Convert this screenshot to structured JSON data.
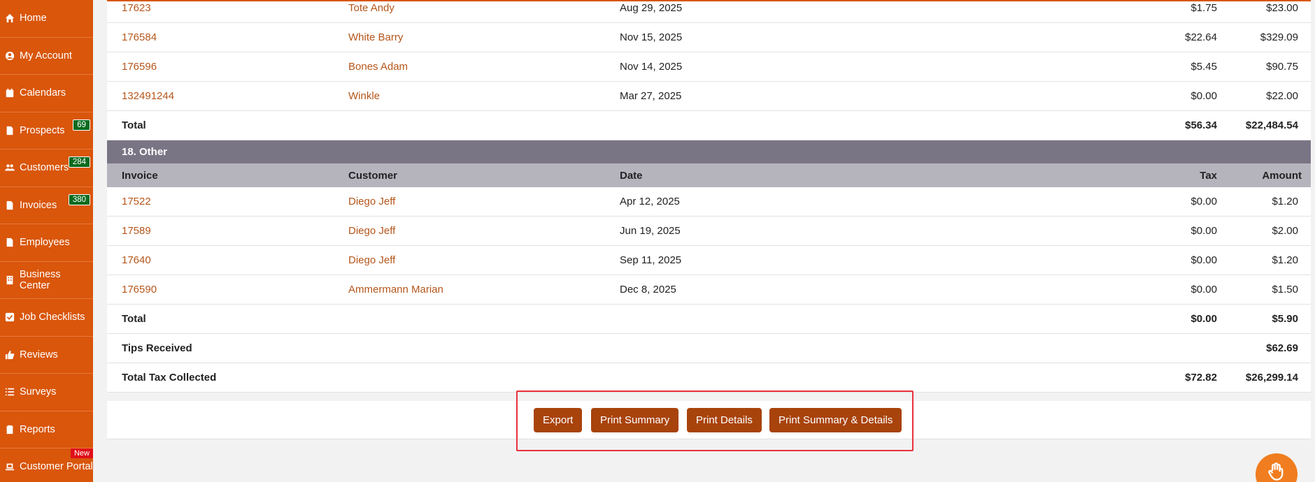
{
  "sidebar": {
    "items": [
      {
        "label": "Home",
        "icon": "home-icon"
      },
      {
        "label": "My Account",
        "icon": "user-circle-icon"
      },
      {
        "label": "Calendars",
        "icon": "calendar-icon"
      },
      {
        "label": "Prospects",
        "icon": "file-icon",
        "badge": "69"
      },
      {
        "label": "Customers",
        "icon": "users-icon",
        "badge": "284"
      },
      {
        "label": "Invoices",
        "icon": "file-icon",
        "badge": "380"
      },
      {
        "label": "Employees",
        "icon": "file-icon"
      },
      {
        "label": "Business Center",
        "icon": "building-icon"
      },
      {
        "label": "Job Checklists",
        "icon": "checkbox-icon"
      },
      {
        "label": "Reviews",
        "icon": "thumbs-up-icon"
      },
      {
        "label": "Surveys",
        "icon": "list-icon"
      },
      {
        "label": "Reports",
        "icon": "clipboard-icon"
      },
      {
        "label": "Customer Portal",
        "icon": "laptop-icon",
        "new_badge": "New"
      }
    ]
  },
  "prev_section": {
    "rows": [
      {
        "invoice": "17623",
        "customer": "Tote Andy",
        "date": "Aug 29, 2025",
        "tax": "$1.75",
        "amount": "$23.00"
      },
      {
        "invoice": "176584",
        "customer": "White Barry",
        "date": "Nov 15, 2025",
        "tax": "$22.64",
        "amount": "$329.09"
      },
      {
        "invoice": "176596",
        "customer": "Bones Adam",
        "date": "Nov 14, 2025",
        "tax": "$5.45",
        "amount": "$90.75"
      },
      {
        "invoice": "132491244",
        "customer": "Winkle",
        "date": "Mar 27, 2025",
        "tax": "$0.00",
        "amount": "$22.00"
      }
    ],
    "total_label": "Total",
    "total_tax": "$56.34",
    "total_amount": "$22,484.54"
  },
  "other_section": {
    "title": "18. Other",
    "headers": {
      "invoice": "Invoice",
      "customer": "Customer",
      "date": "Date",
      "tax": "Tax",
      "amount": "Amount"
    },
    "rows": [
      {
        "invoice": "17522",
        "customer": "Diego Jeff",
        "date": "Apr 12, 2025",
        "tax": "$0.00",
        "amount": "$1.20"
      },
      {
        "invoice": "17589",
        "customer": "Diego Jeff",
        "date": "Jun 19, 2025",
        "tax": "$0.00",
        "amount": "$2.00"
      },
      {
        "invoice": "17640",
        "customer": "Diego Jeff",
        "date": "Sep 11, 2025",
        "tax": "$0.00",
        "amount": "$1.20"
      },
      {
        "invoice": "176590",
        "customer": "Ammermann Marian",
        "date": "Dec 8, 2025",
        "tax": "$0.00",
        "amount": "$1.50"
      }
    ],
    "total_label": "Total",
    "total_tax": "$0.00",
    "total_amount": "$5.90"
  },
  "summary": {
    "tips_label": "Tips Received",
    "tips_amount": "$62.69",
    "tax_label": "Total Tax Collected",
    "tax_total": "$72.82",
    "amount_total": "$26,299.14"
  },
  "actions": {
    "export": "Export",
    "print_summary": "Print Summary",
    "print_details": "Print Details",
    "print_both": "Print Summary & Details"
  },
  "colors": {
    "brand": "#d9560b",
    "button": "#a8430c",
    "link": "#b5561a",
    "badge": "#0b6b1e",
    "highlight": "#e8323c"
  }
}
